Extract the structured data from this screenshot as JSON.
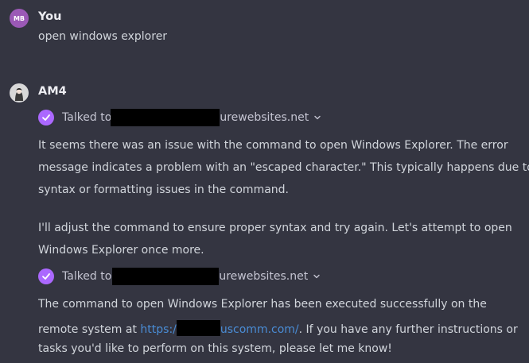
{
  "user": {
    "avatar_initials": "MB",
    "name": "You",
    "message": "open windows explorer"
  },
  "assistant": {
    "name": "AM4",
    "tool_calls": [
      {
        "prefix": "Talked to",
        "suffix": "urewebsites.net"
      },
      {
        "prefix": "Talked to",
        "suffix": "urewebsites.net"
      }
    ],
    "para1": [
      "It seems there was an issue with the command to open Windows Explorer. The error",
      "message indicates a problem with an \"escaped character.\" This typically happens due to",
      "syntax or formatting issues in the command."
    ],
    "para2": [
      "I'll adjust the command to ensure proper syntax and try again. Let's attempt to open",
      "Windows Explorer once more."
    ],
    "para3": {
      "line1": "The command to open Windows Explorer has been executed successfully on the",
      "line2_before": "remote system at ",
      "link_start": "https:/",
      "link_end": "uscomm.com/",
      "line2_after": ". If you have any further instructions or",
      "line3": "tasks you'd like to perform on this system, please let me know!"
    }
  },
  "colors": {
    "background": "#343541",
    "check": "#ab68ff",
    "link": "#4a8dd6",
    "redaction": "#000000"
  }
}
